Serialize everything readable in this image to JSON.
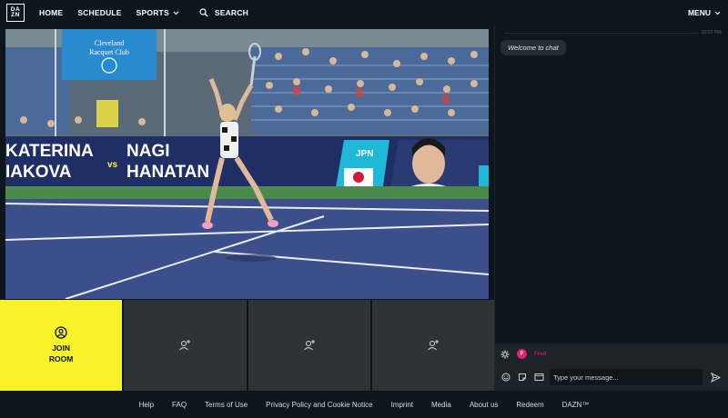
{
  "header": {
    "logo_top": "DA",
    "logo_bottom": "ZN",
    "nav": [
      {
        "label": "HOME"
      },
      {
        "label": "SCHEDULE"
      },
      {
        "label": "SPORTS"
      },
      {
        "label": "SEARCH"
      }
    ],
    "menu_label": "MENU"
  },
  "video": {
    "banner_sign": "CLEVELAND RACQUET CLUB",
    "sign_line1": "Cleveland",
    "sign_line2": "Racquet Club",
    "board_left_top": "KATERINA",
    "board_left_bottom": "IAKOVA",
    "board_vs": "vs",
    "board_right_top": "NAGI",
    "board_right_bottom": "HANATAN",
    "country": "JPN"
  },
  "tiles": {
    "join_label": "JOIN ROOM"
  },
  "chat": {
    "time": "10:52 PM",
    "welcome": "Welcome to chat",
    "user_initial": "F",
    "username": "Fred",
    "placeholder": "Type your message..."
  },
  "footer": {
    "links": [
      "Help",
      "FAQ",
      "Terms of Use",
      "Privacy Policy and Cookie Notice",
      "Imprint",
      "Media",
      "About us",
      "Redeem",
      "DAZN™"
    ]
  },
  "colors": {
    "background": "#0c161c",
    "accent_yellow": "#f7f22a",
    "tile_gray": "#2e3338",
    "chat_user_pink": "#e61e73",
    "court_blue": "#3d4f8a"
  }
}
